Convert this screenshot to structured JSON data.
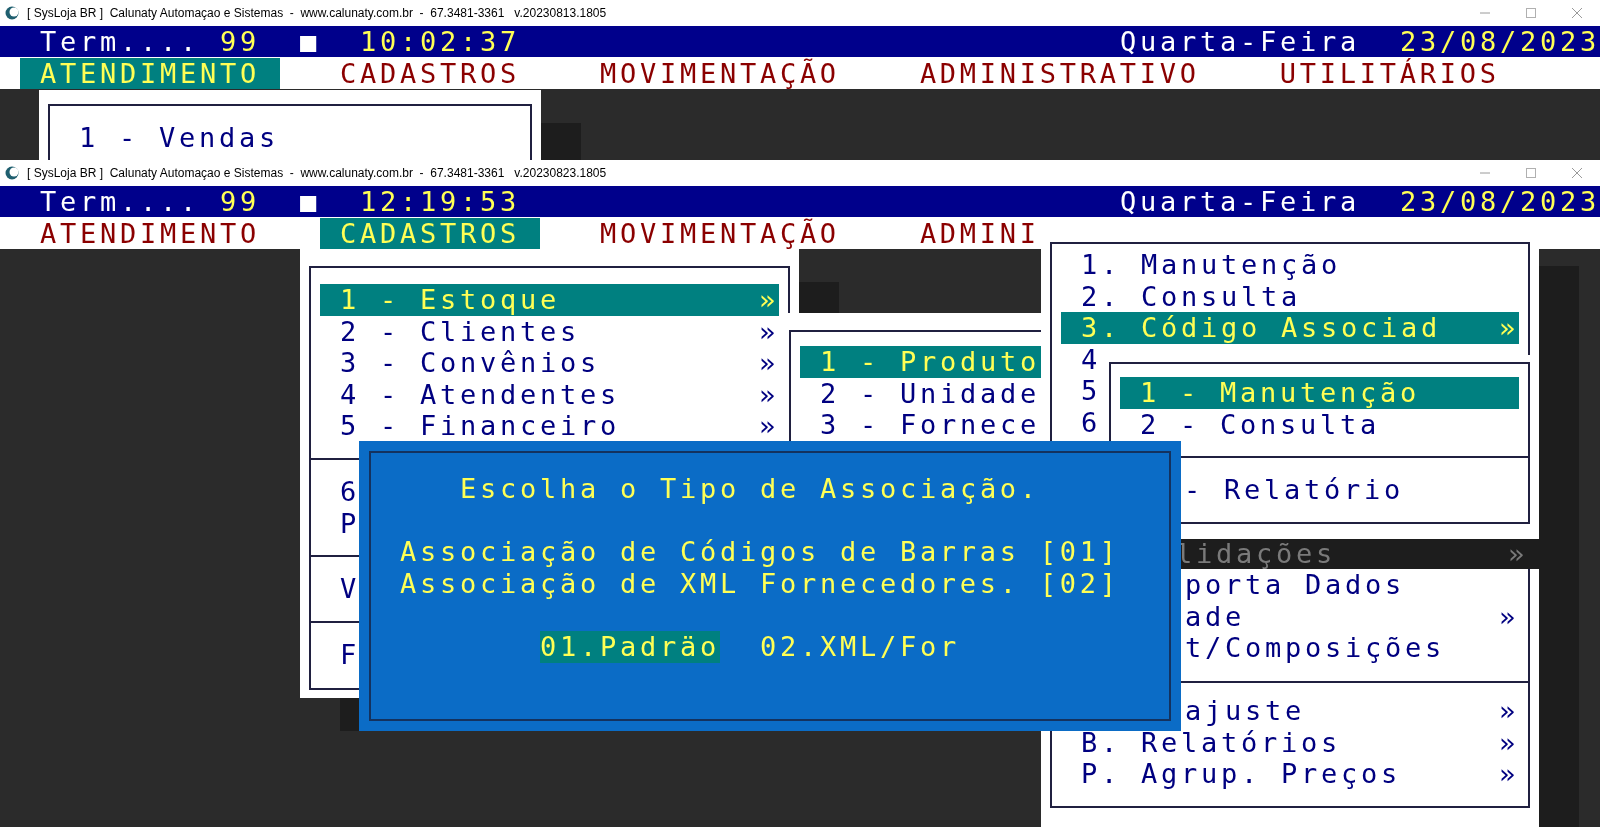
{
  "windows": [
    {
      "title": "[ SysLoja BR ]  Calunaty Automaçao e Sistemas  -  www.calunaty.com.br  -  67.3481-3361   v.20230813.1805",
      "status": {
        "term_label": "Term....",
        "term": "99",
        "marker": "■",
        "time": "10:02:37",
        "weekday": "Quarta-Feira",
        "date": "23/08/2023"
      },
      "menu": [
        {
          "label": "ATENDIMENTO",
          "selected": true
        },
        {
          "label": "CADASTROS",
          "selected": false
        },
        {
          "label": "MOVIMENTAÇÃO",
          "selected": false
        },
        {
          "label": "ADMINISTRATIVO",
          "selected": false
        },
        {
          "label": "UTILITÁRIOS",
          "selected": false
        }
      ],
      "menus": [
        {
          "groups": [
            [
              {
                "label": "1 - Vendas",
                "selected": false
              }
            ]
          ]
        }
      ]
    },
    {
      "title": "[ SysLoja BR ]  Calunaty Automaçao e Sistemas  -  www.calunaty.com.br  -  67.3481-3361   v.20230823.1805",
      "status": {
        "term_label": "Term....",
        "term": "99",
        "marker": "■",
        "time": "12:19:53",
        "weekday": "Quarta-Feira",
        "date": "23/08/2023"
      },
      "menu": [
        {
          "label": "ATENDIMENTO",
          "selected": false
        },
        {
          "label": "CADASTROS",
          "selected": true
        },
        {
          "label": "MOVIMENTAÇÃO",
          "selected": false
        },
        {
          "label": "ADMINI",
          "selected": false
        }
      ],
      "menus": [
        {
          "groups": [
            [
              {
                "label": "1 - Estoque",
                "arrow": "»",
                "selected": true
              },
              {
                "label": "2 - Clientes",
                "arrow": "»",
                "selected": false
              },
              {
                "label": "3 - Convênios",
                "arrow": "»",
                "selected": false
              },
              {
                "label": "4 - Atendentes",
                "arrow": "»",
                "selected": false
              },
              {
                "label": "5 - Financeiro",
                "arrow": "»",
                "selected": false
              }
            ],
            [
              {
                "label": "6",
                "selected": false
              },
              {
                "label": "P",
                "selected": false
              }
            ],
            [
              {
                "label": "V",
                "selected": false
              }
            ],
            [
              {
                "label": "F",
                "selected": false
              }
            ]
          ]
        },
        {
          "groups": [
            [
              {
                "label": "1 - Produto",
                "selected": true
              },
              {
                "label": "2 - Unidade",
                "selected": false
              },
              {
                "label": "3 - Fornece",
                "selected": false
              }
            ]
          ]
        },
        {
          "groups": [
            [
              {
                "label": "1. Manutenção",
                "selected": false,
                "dimmed": false
              },
              {
                "label": "2. Consulta",
                "selected": false,
                "dimmed": false
              },
              {
                "label": "3. Código Associad",
                "arrow": "»",
                "selected": true,
                "dimmed": false
              },
              {
                "label": "4",
                "selected": false,
                "dimmed": false
              },
              {
                "label": "5",
                "selected": false,
                "dimmed": false
              },
              {
                "label": "6",
                "selected": false,
                "dimmed": false
              }
            ],
            [
              {
                "label": "lidações",
                "arrow": "»",
                "selected": false,
                "dimmed": true
              },
              {
                "label": "porta Dados",
                "selected": false,
                "dimmed": false
              },
              {
                "label": "ade",
                "arrow": "»",
                "selected": false,
                "dimmed": false
              },
              {
                "label": "t/Composições",
                "selected": false,
                "dimmed": false
              }
            ],
            [
              {
                "label": "ajuste",
                "arrow": "»",
                "selected": false,
                "dimmed": false
              },
              {
                "label": "B. Relatórios",
                "arrow": "»",
                "selected": false,
                "dimmed": false
              },
              {
                "label": "P. Agrup. Preços",
                "arrow": "»",
                "selected": false,
                "dimmed": false
              }
            ]
          ]
        },
        {
          "groups": [
            [
              {
                "label": "1 - Manutenção",
                "selected": true
              },
              {
                "label": "2 - Consulta",
                "selected": false
              }
            ],
            [
              {
                "label": "- Relatório",
                "selected": false
              }
            ]
          ]
        }
      ]
    }
  ],
  "dialog": {
    "title": "Escolha o Tipo de Associação.",
    "lines": [
      "Associação de Códigos de Barras [01]",
      "Associação de XML Fornecedores. [02]"
    ],
    "options": [
      {
        "label": "01.Padräo",
        "selected": true
      },
      {
        "label": "02.XML/For",
        "selected": false
      }
    ]
  }
}
